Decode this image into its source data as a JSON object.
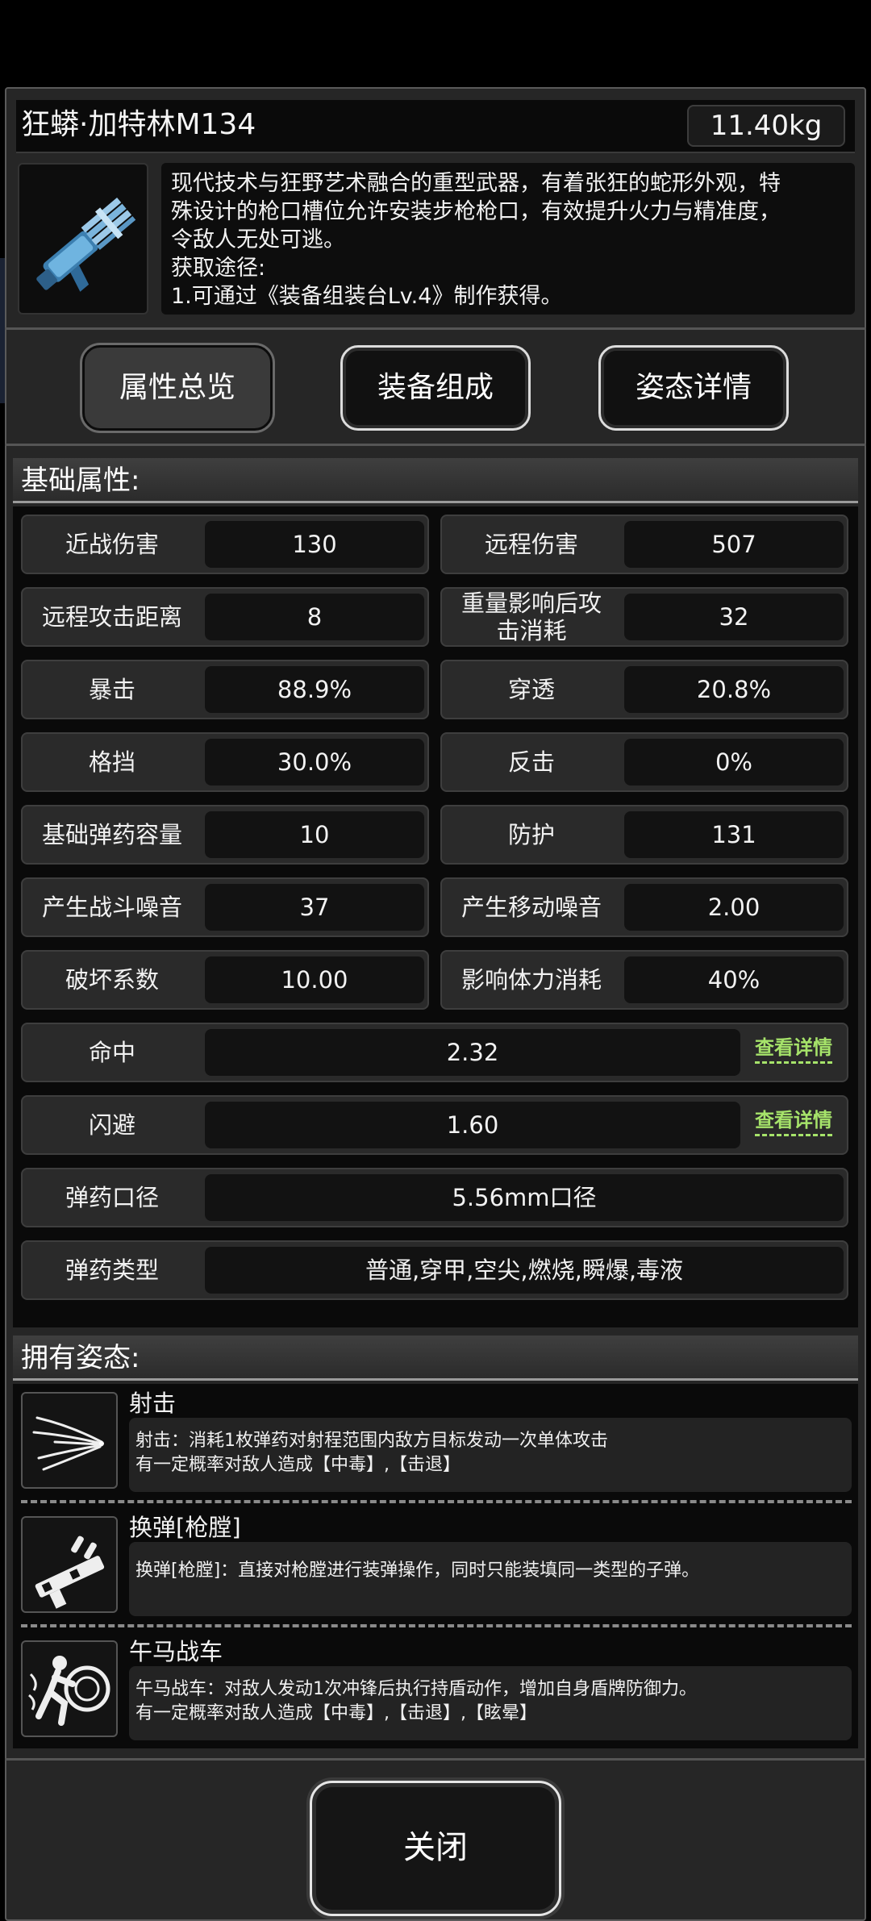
{
  "item": {
    "name": "狂蟒·加特林M134",
    "weight": "11.40kg",
    "description": [
      "现代技术与狂野艺术融合的重型武器，有着张狂的蛇形外观，特",
      "殊设计的枪口槽位允许安装步枪枪口，有效提升火力与精准度，",
      "令敌人无处可逃。",
      "获取途径:",
      "1.可通过《装备组装台Lv.4》制作获得。"
    ]
  },
  "tabs": [
    "属性总览",
    "装备组成",
    "姿态详情"
  ],
  "basic_header": "基础属性:",
  "stats": {
    "melee_damage": {
      "label": "近战伤害",
      "value": "130"
    },
    "ranged_damage": {
      "label": "远程伤害",
      "value": "507"
    },
    "ranged_distance": {
      "label": "远程攻击距离",
      "value": "8"
    },
    "weight_cost": {
      "label": "重量影响后攻击消耗",
      "value": "32"
    },
    "crit": {
      "label": "暴击",
      "value": "88.9%"
    },
    "penetrate": {
      "label": "穿透",
      "value": "20.8%"
    },
    "block": {
      "label": "格挡",
      "value": "30.0%"
    },
    "counter": {
      "label": "反击",
      "value": "0%"
    },
    "ammo_capacity": {
      "label": "基础弹药容量",
      "value": "10"
    },
    "defense": {
      "label": "防护",
      "value": "131"
    },
    "combat_noise": {
      "label": "产生战斗噪音",
      "value": "37"
    },
    "move_noise": {
      "label": "产生移动噪音",
      "value": "2.00"
    },
    "destroy": {
      "label": "破坏系数",
      "value": "10.00"
    },
    "stamina": {
      "label": "影响体力消耗",
      "value": "40%"
    },
    "hit": {
      "label": "命中",
      "value": "2.32",
      "link": "查看详情"
    },
    "dodge": {
      "label": "闪避",
      "value": "1.60",
      "link": "查看详情"
    },
    "caliber": {
      "label": "弹药口径",
      "value": "5.56mm口径"
    },
    "ammo_types": {
      "label": "弹药类型",
      "value": "普通,穿甲,空尖,燃烧,瞬爆,毒液"
    }
  },
  "stance_header": "拥有姿态:",
  "stances": [
    {
      "icon": "shoot-icon",
      "title": "射击",
      "lines": [
        "射击：消耗1枚弹药对射程范围内敌方目标发动一次单体攻击",
        "有一定概率对敌人造成【中毒】,【击退】"
      ]
    },
    {
      "icon": "reload-icon",
      "title": "换弹[枪膛]",
      "lines": [
        "换弹[枪膛]：直接对枪膛进行装弹操作，同时只能装填同一类型的子弹。"
      ]
    },
    {
      "icon": "charge-icon",
      "title": "午马战车",
      "lines": [
        "午马战车：对敌人发动1次冲锋后执行持盾动作，增加自身盾牌防御力。",
        "有一定概率对敌人造成【中毒】,【击退】,【眩晕】"
      ]
    }
  ],
  "close_label": "关闭"
}
